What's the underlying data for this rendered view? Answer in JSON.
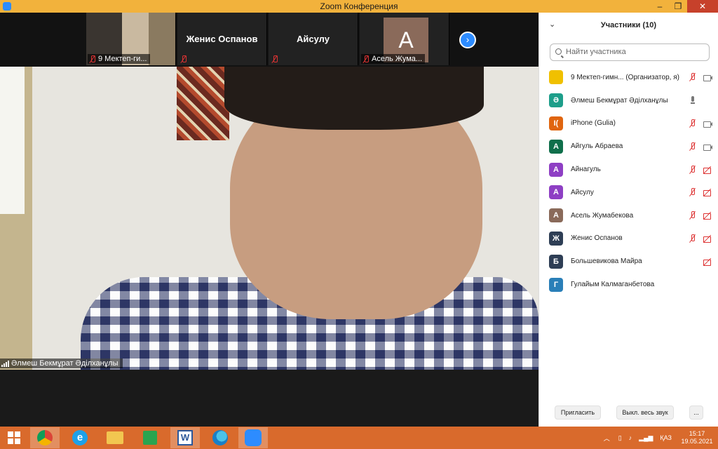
{
  "window": {
    "title": "Zoom Конференция",
    "controls": [
      "–",
      "❐",
      "✕"
    ]
  },
  "gallery": {
    "thumbs": [
      {
        "label": "9 Мектеп-ги..."
      },
      {
        "name": "Женис Оспанов"
      },
      {
        "name": "Айсулу"
      },
      {
        "initial": "А",
        "label": "Асель Жума..."
      }
    ],
    "next_glyph": "›"
  },
  "speaker": {
    "name": "Әлмеш Бекмұрат Әділханұлы"
  },
  "participants": {
    "title": "Участники (10)",
    "search_placeholder": "Найти участника",
    "list": [
      {
        "initial": "",
        "color": "#f0c000",
        "name": "9 Мектеп-гимн... (Организатор, я)",
        "mic": "micoff",
        "cam": "cam"
      },
      {
        "initial": "Ә",
        "color": "#1d9e8a",
        "name": "Әлмеш Бекмұрат Әділханұлы",
        "mic": "mic",
        "cam": "blank"
      },
      {
        "initial": "I(",
        "color": "#e0650f",
        "name": "iPhone (Gulia)",
        "mic": "micoff",
        "cam": "cam"
      },
      {
        "initial": "А",
        "color": "#0f6f4b",
        "name": "Айгуль Абраева",
        "mic": "micoff",
        "cam": "cam"
      },
      {
        "initial": "А",
        "color": "#8e3fc4",
        "name": "Айнагуль",
        "mic": "micoff",
        "cam": "camoff"
      },
      {
        "initial": "А",
        "color": "#8e3fc4",
        "name": "Айсулу",
        "mic": "micoff",
        "cam": "camoff"
      },
      {
        "initial": "А",
        "color": "#8a6a5a",
        "name": "Асель Жумабекова",
        "mic": "micoff",
        "cam": "camoff"
      },
      {
        "initial": "Ж",
        "color": "#2e3e55",
        "name": "Женис Оспанов",
        "mic": "micoff",
        "cam": "camoff"
      },
      {
        "initial": "Б",
        "color": "#2e3e55",
        "name": "Большевикова Майра",
        "mic": "blank",
        "cam": "camoff"
      },
      {
        "initial": "Г",
        "color": "#2a7fb8",
        "name": "Гулайым Калмаганбетова",
        "mic": "blank",
        "cam": "blank"
      }
    ],
    "invite_label": "Пригласить",
    "mute_all_label": "Выкл. весь звук",
    "more_label": "..."
  },
  "taskbar": {
    "lang": "ҚАЗ",
    "time": "15:17",
    "date": "19.05.2021"
  }
}
